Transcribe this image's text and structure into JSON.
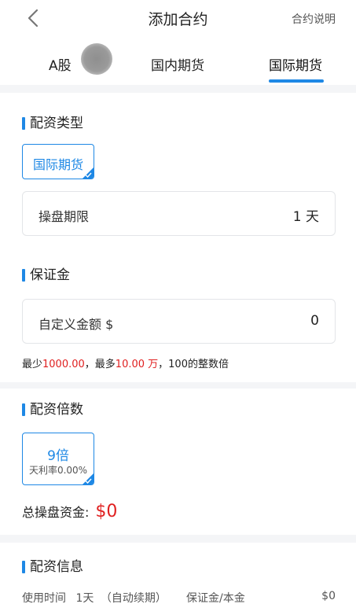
{
  "header": {
    "title": "添加合约",
    "help_link": "合约说明"
  },
  "tabs": [
    {
      "label": "A股"
    },
    {
      "label": "国内期货"
    },
    {
      "label": "国际期货",
      "active": true
    }
  ],
  "allocation_type": {
    "title": "配资类型",
    "option": "国际期货",
    "duration_label": "操盘期限",
    "duration_value": "1 天"
  },
  "margin": {
    "title": "保证金",
    "custom_label": "自定义金额 $",
    "custom_value": "0",
    "hint_prefix": "最少",
    "hint_min": "1000.00",
    "hint_mid": "，最多",
    "hint_max": "10.00 万",
    "hint_suffix": "，100的整数倍"
  },
  "multiplier": {
    "title": "配资倍数",
    "option_label": "9倍",
    "option_rate": "天利率0.00%"
  },
  "total": {
    "label": "总操盘资金:",
    "value": "$0"
  },
  "info": {
    "title": "配资信息",
    "use_time_label": "使用时间",
    "use_time_value": "1天",
    "renew_note": "（自动续期）",
    "principal_label": "保证金/本金",
    "principal_value": "$0"
  },
  "colors": {
    "accent": "#1e88e5",
    "highlight_red": "#e02020"
  }
}
